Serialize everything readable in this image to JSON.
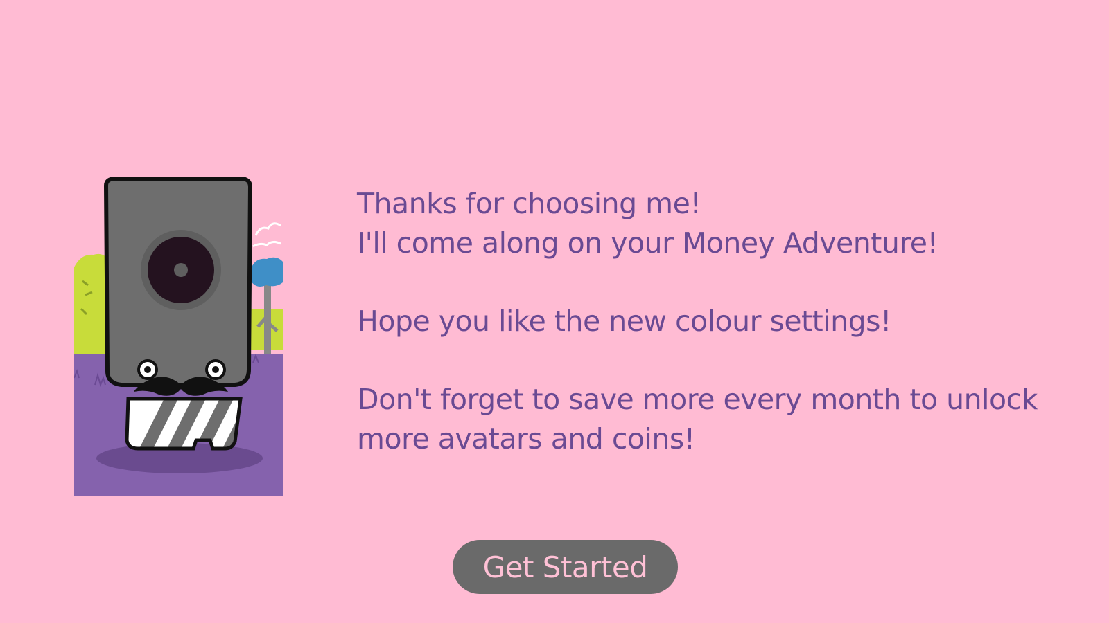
{
  "colors": {
    "background": "#ffbbd3",
    "text": "#6a4a93",
    "button_bg": "#6a6a6a",
    "button_text": "#ffc1d6",
    "ground": "#8562ad"
  },
  "avatar": {
    "icon": "speaker-mustache-avatar-icon"
  },
  "message": {
    "line1": "Thanks for choosing me!",
    "line2": "I'll come along on your Money Adventure!",
    "line3": "Hope you like the new colour settings!",
    "line4": "Don't forget to save more every month to unlock",
    "line5": "more avatars and coins!"
  },
  "button": {
    "label": "Get Started"
  }
}
